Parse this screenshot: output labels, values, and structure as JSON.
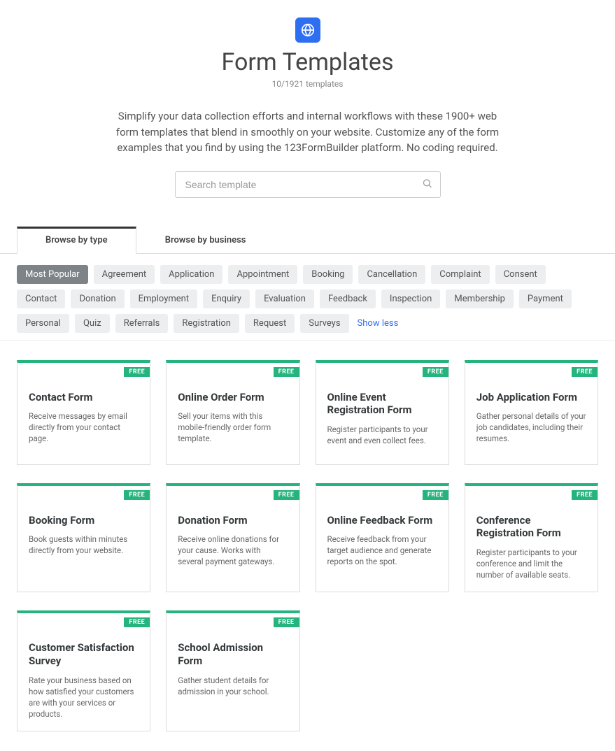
{
  "hero": {
    "title": "Form Templates",
    "count_text": "10/1921 templates",
    "intro": "Simplify your data collection efforts and internal workflows with these 1900+ web form templates that blend in smoothly on your website. Customize any of the form examples that you find by using the 123FormBuilder platform. No coding required.",
    "search_placeholder": "Search template"
  },
  "tabs": [
    {
      "label": "Browse by type",
      "active": true
    },
    {
      "label": "Browse by business",
      "active": false
    }
  ],
  "filters": {
    "items": [
      {
        "label": "Most Popular",
        "active": true
      },
      {
        "label": "Agreement"
      },
      {
        "label": "Application"
      },
      {
        "label": "Appointment"
      },
      {
        "label": "Booking"
      },
      {
        "label": "Cancellation"
      },
      {
        "label": "Complaint"
      },
      {
        "label": "Consent"
      },
      {
        "label": "Contact"
      },
      {
        "label": "Donation"
      },
      {
        "label": "Employment"
      },
      {
        "label": "Enquiry"
      },
      {
        "label": "Evaluation"
      },
      {
        "label": "Feedback"
      },
      {
        "label": "Inspection"
      },
      {
        "label": "Membership"
      },
      {
        "label": "Payment"
      },
      {
        "label": "Personal"
      },
      {
        "label": "Quiz"
      },
      {
        "label": "Referrals"
      },
      {
        "label": "Registration"
      },
      {
        "label": "Request"
      },
      {
        "label": "Surveys"
      }
    ],
    "toggle_label": "Show less"
  },
  "cards": [
    {
      "badge": "FREE",
      "title": "Contact Form",
      "desc": "Receive messages by email directly from your contact page."
    },
    {
      "badge": "FREE",
      "title": "Online Order Form",
      "desc": "Sell your items with this mobile-friendly order form template."
    },
    {
      "badge": "FREE",
      "title": "Online Event Registration Form",
      "desc": "Register participants to your event and even collect fees."
    },
    {
      "badge": "FREE",
      "title": "Job Application Form",
      "desc": "Gather personal details of your job candidates, including their resumes."
    },
    {
      "badge": "FREE",
      "title": "Booking Form",
      "desc": "Book guests within minutes directly from your website."
    },
    {
      "badge": "FREE",
      "title": "Donation Form",
      "desc": "Receive online donations for your cause. Works with several payment gateways."
    },
    {
      "badge": "FREE",
      "title": "Online Feedback Form",
      "desc": "Receive feedback from your target audience and generate reports on the spot."
    },
    {
      "badge": "FREE",
      "title": "Conference Registration Form",
      "desc": "Register participants to your conference and limit the number of available seats."
    },
    {
      "badge": "FREE",
      "title": "Customer Satisfaction Survey",
      "desc": "Rate your business based on how satisfied your customers are with your services or products."
    },
    {
      "badge": "FREE",
      "title": "School Admission Form",
      "desc": "Gather student details for admission in your school."
    }
  ]
}
